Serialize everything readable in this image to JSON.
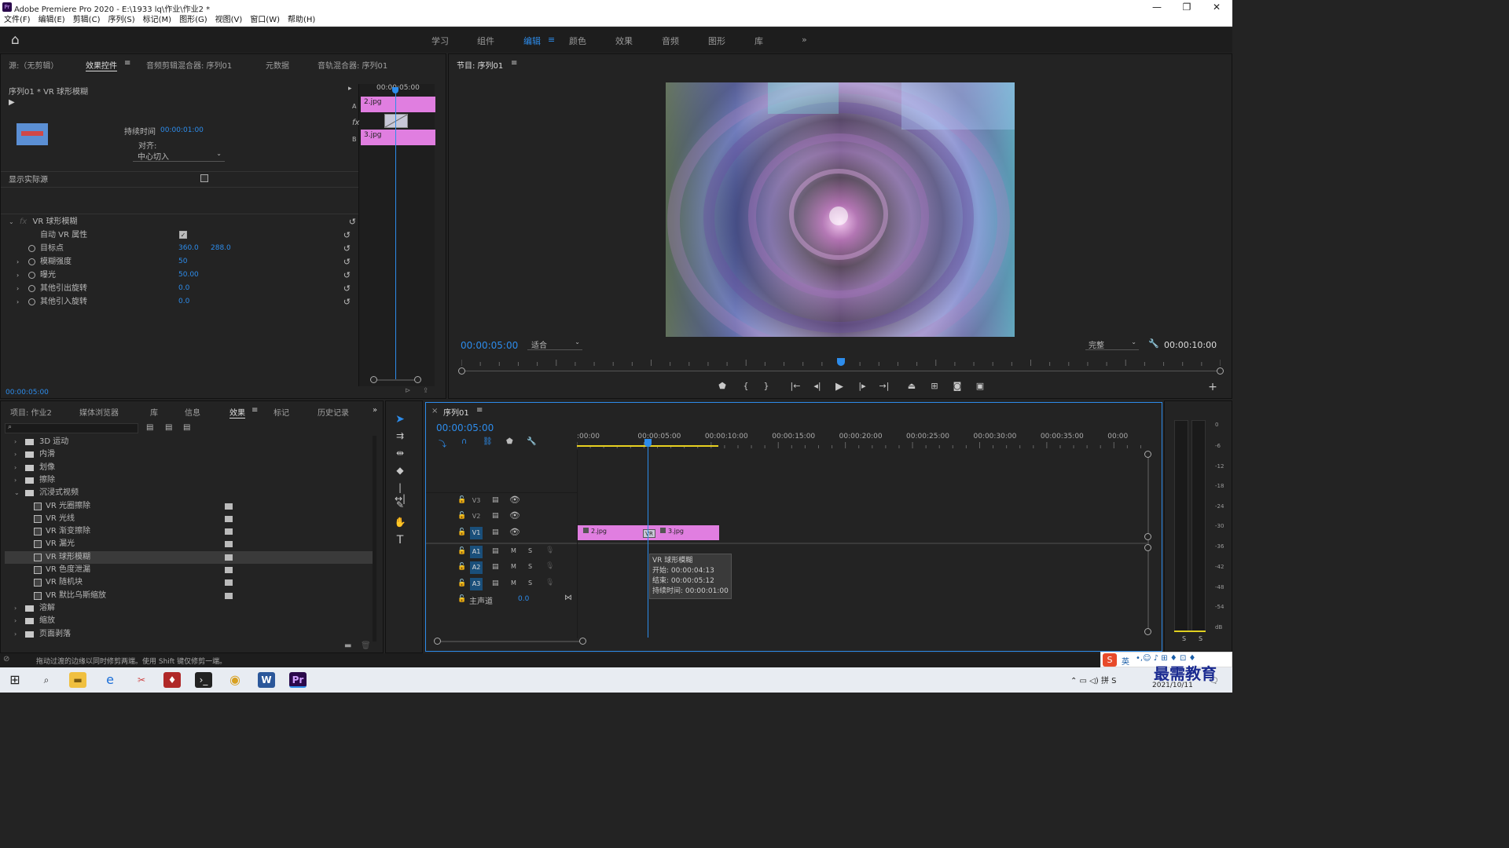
{
  "titlebar": {
    "title": "Adobe Premiere Pro 2020 - E:\\1933 lq\\作业\\作业2 *",
    "app_icon": "Pr",
    "minimize": "—",
    "maximize": "❐",
    "close": "✕"
  },
  "menu": [
    "文件(F)",
    "编辑(E)",
    "剪辑(C)",
    "序列(S)",
    "标记(M)",
    "图形(G)",
    "视图(V)",
    "窗口(W)",
    "帮助(H)"
  ],
  "workspaces": {
    "items": [
      "学习",
      "组件",
      "编辑",
      "颜色",
      "效果",
      "音频",
      "图形",
      "库"
    ],
    "active": "编辑",
    "menu_icon": "≡",
    "more": "»",
    "home_icon": "⌂"
  },
  "effect_controls": {
    "tabs": [
      "源:（无剪辑）",
      "效果控件",
      "音频剪辑混合器: 序列01",
      "元数据",
      "音轨混合器: 序列01"
    ],
    "active_tab": "效果控件",
    "header": "序列01 * VR 球形模糊",
    "timeline_time": "00:00:05:00",
    "clip_a": "2.jpg",
    "clip_b": "3.jpg",
    "label_a": "A",
    "label_b": "B",
    "fx_label": "fx",
    "duration_label": "持续时间",
    "duration_value": "00:00:01:00",
    "align_label": "对齐:",
    "align_value": "中心切入",
    "show_source": "显示实际源",
    "effect_name": "VR 球形模糊",
    "params": [
      {
        "name": "自动 VR 属性",
        "value": "",
        "value2": "",
        "checkbox": true
      },
      {
        "name": "目标点",
        "value": "360.0",
        "value2": "288.0"
      },
      {
        "name": "模糊强度",
        "value": "50",
        "value2": ""
      },
      {
        "name": "曝光",
        "value": "50.00",
        "value2": ""
      },
      {
        "name": "其他引出旋转",
        "value": "0.0",
        "value2": ""
      },
      {
        "name": "其他引入旋转",
        "value": "0.0",
        "value2": ""
      }
    ],
    "current_time": "00:00:05:00"
  },
  "program": {
    "title": "节目: 序列01",
    "timecode": "00:00:05:00",
    "fit": "适合",
    "quality": "完整",
    "duration": "00:00:10:00",
    "controls": [
      "marker-icon",
      "mark-in-icon",
      "mark-out-icon",
      "go-to-in-icon",
      "step-back-icon",
      "play-icon",
      "step-forward-icon",
      "go-to-out-icon",
      "lift-icon",
      "extract-icon",
      "export-frame-icon",
      "comparison-view-icon"
    ],
    "playhead_fraction": 0.5
  },
  "project": {
    "tabs": [
      "项目: 作业2",
      "媒体浏览器",
      "库",
      "信息",
      "效果",
      "标记",
      "历史记录"
    ],
    "active_tab": "效果",
    "search_placeholder": "",
    "tree": [
      {
        "label": "3D 运动",
        "type": "folder",
        "level": 0
      },
      {
        "label": "内滑",
        "type": "folder",
        "level": 0
      },
      {
        "label": "划像",
        "type": "folder",
        "level": 0
      },
      {
        "label": "擦除",
        "type": "folder",
        "level": 0
      },
      {
        "label": "沉浸式视频",
        "type": "folder",
        "level": 0,
        "open": true
      },
      {
        "label": "VR 光圈擦除",
        "type": "effect",
        "level": 1
      },
      {
        "label": "VR 光线",
        "type": "effect",
        "level": 1
      },
      {
        "label": "VR 渐变擦除",
        "type": "effect",
        "level": 1
      },
      {
        "label": "VR 漏光",
        "type": "effect",
        "level": 1
      },
      {
        "label": "VR 球形模糊",
        "type": "effect",
        "level": 1,
        "selected": true
      },
      {
        "label": "VR 色度泄漏",
        "type": "effect",
        "level": 1
      },
      {
        "label": "VR 随机块",
        "type": "effect",
        "level": 1
      },
      {
        "label": "VR 默比乌斯缩放",
        "type": "effect",
        "level": 1
      },
      {
        "label": "溶解",
        "type": "folder",
        "level": 0
      },
      {
        "label": "缩放",
        "type": "folder",
        "level": 0
      },
      {
        "label": "页面剥落",
        "type": "folder",
        "level": 0
      }
    ]
  },
  "timeline": {
    "title": "序列01",
    "timecode": "00:00:05:00",
    "ruler": [
      ":00:00",
      "00:00:05:00",
      "00:00:10:00",
      "00:00:15:00",
      "00:00:20:00",
      "00:00:25:00",
      "00:00:30:00",
      "00:00:35:00",
      "00:00"
    ],
    "video_tracks": [
      "V3",
      "V2",
      "V1"
    ],
    "audio_tracks": [
      "A1",
      "A2",
      "A3"
    ],
    "master_label": "主声道",
    "master_value": "0.0",
    "clips": [
      {
        "label": "2.jpg"
      },
      {
        "label": "3.jpg"
      }
    ],
    "transition_label": "VR",
    "tooltip": [
      "VR 球形模糊",
      "开始: 00:00:04:13",
      "结束: 00:00:05:12",
      "持续时间: 00:00:01:00"
    ],
    "m_label": "M",
    "s_label": "S"
  },
  "audio_meter": {
    "scale": [
      "0",
      "-6",
      "-12",
      "-18",
      "-24",
      "-30",
      "-36",
      "-42",
      "-48",
      "-54",
      "dB"
    ],
    "solo_labels": [
      "S",
      "S"
    ]
  },
  "status": {
    "text": "拖动过渡的边缘以同时修剪两端。使用 Shift 键仅修剪一端。"
  },
  "taskbar": {
    "date": "2021/10/11",
    "ime": "英"
  },
  "watermark": "最需教育",
  "colors": {
    "accent": "#2d8ceb",
    "clip": "#e07ee0",
    "panel": "#232323"
  }
}
